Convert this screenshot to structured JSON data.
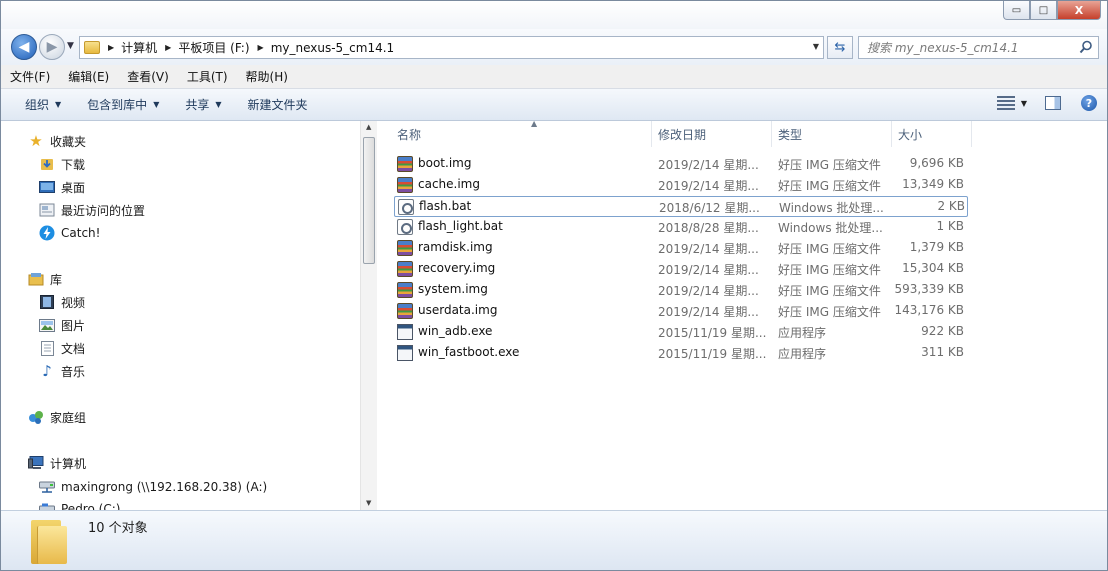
{
  "window": {
    "minimize_glyph": "▭",
    "maximize_glyph": "□",
    "close_glyph": "X"
  },
  "navigation": {
    "back_glyph": "◀",
    "forward_glyph": "▶",
    "breadcrumbs": [
      "计算机",
      "平板项目 (F:)",
      "my_nexus-5_cm14.1"
    ],
    "search_placeholder": "搜索 my_nexus-5_cm14.1"
  },
  "menu": [
    "文件(F)",
    "编辑(E)",
    "查看(V)",
    "工具(T)",
    "帮助(H)"
  ],
  "commands": {
    "organize": "组织",
    "include_in_library": "包含到库中",
    "share": "共享",
    "new_folder": "新建文件夹"
  },
  "sidebar": {
    "favorites_header": "收藏夹",
    "favorites": [
      "下载",
      "桌面",
      "最近访问的位置",
      "Catch!"
    ],
    "libraries_header": "库",
    "libraries": [
      "视频",
      "图片",
      "文档",
      "音乐"
    ],
    "homegroup": "家庭组",
    "computer_header": "计算机",
    "drives": [
      "maxingrong (\\\\192.168.20.38) (A:)",
      "Pedro (C:)"
    ]
  },
  "columns": {
    "name": "名称",
    "date": "修改日期",
    "type": "类型",
    "size": "大小"
  },
  "files": [
    {
      "name": "boot.img",
      "date": "2019/2/14 星期...",
      "type": "好压 IMG 压缩文件",
      "size": "9,696 KB",
      "icon": "archive-icon"
    },
    {
      "name": "cache.img",
      "date": "2019/2/14 星期...",
      "type": "好压 IMG 压缩文件",
      "size": "13,349 KB",
      "icon": "archive-icon"
    },
    {
      "name": "flash.bat",
      "date": "2018/6/12 星期...",
      "type": "Windows 批处理...",
      "size": "2 KB",
      "icon": "batch-file-icon"
    },
    {
      "name": "flash_light.bat",
      "date": "2018/8/28 星期...",
      "type": "Windows 批处理...",
      "size": "1 KB",
      "icon": "batch-file-icon"
    },
    {
      "name": "ramdisk.img",
      "date": "2019/2/14 星期...",
      "type": "好压 IMG 压缩文件",
      "size": "1,379 KB",
      "icon": "archive-icon"
    },
    {
      "name": "recovery.img",
      "date": "2019/2/14 星期...",
      "type": "好压 IMG 压缩文件",
      "size": "15,304 KB",
      "icon": "archive-icon"
    },
    {
      "name": "system.img",
      "date": "2019/2/14 星期...",
      "type": "好压 IMG 压缩文件",
      "size": "593,339 KB",
      "icon": "archive-icon"
    },
    {
      "name": "userdata.img",
      "date": "2019/2/14 星期...",
      "type": "好压 IMG 压缩文件",
      "size": "143,176 KB",
      "icon": "archive-icon"
    },
    {
      "name": "win_adb.exe",
      "date": "2015/11/19 星期...",
      "type": "应用程序",
      "size": "922 KB",
      "icon": "application-icon"
    },
    {
      "name": "win_fastboot.exe",
      "date": "2015/11/19 星期...",
      "type": "应用程序",
      "size": "311 KB",
      "icon": "application-icon"
    }
  ],
  "status": {
    "item_count": "10 个对象"
  }
}
